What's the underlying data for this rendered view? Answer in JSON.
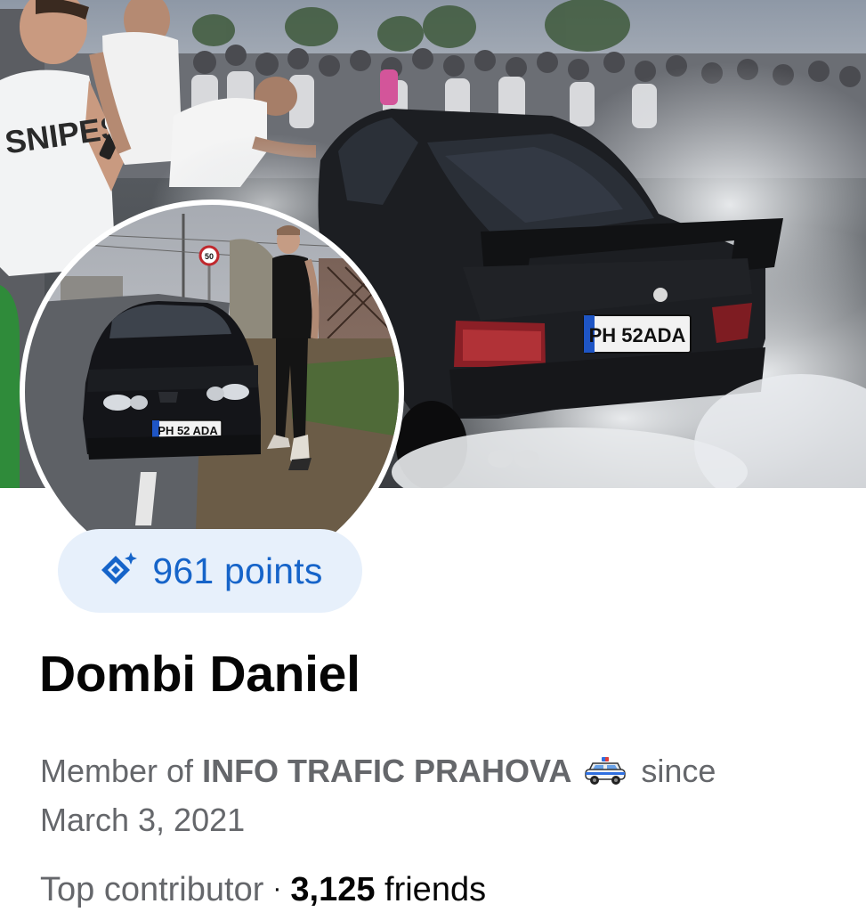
{
  "cover": {
    "rear_plate_text": "PH 52ADA",
    "shirt_text": "SNIPES"
  },
  "avatar": {
    "plate_text": "PH 52 ADA",
    "speed_sign_text": "50"
  },
  "points": {
    "icon": "sparkle-diamond-icon",
    "label": "961 points"
  },
  "profile": {
    "name": "Dombi Daniel",
    "member_prefix": "Member of ",
    "group_name": "INFO TRAFIC PRAHOVA",
    "group_emoji": "police-car-icon",
    "member_since_word": " since",
    "member_date": "March 3, 2021",
    "badge": "Top contributor",
    "separator": "·",
    "friends_count": "3,125",
    "friends_label": " friends"
  },
  "colors": {
    "points_text": "#1664c9",
    "points_bg": "#e7f0fb",
    "secondary_text": "#65676b",
    "primary_text": "#050505"
  }
}
